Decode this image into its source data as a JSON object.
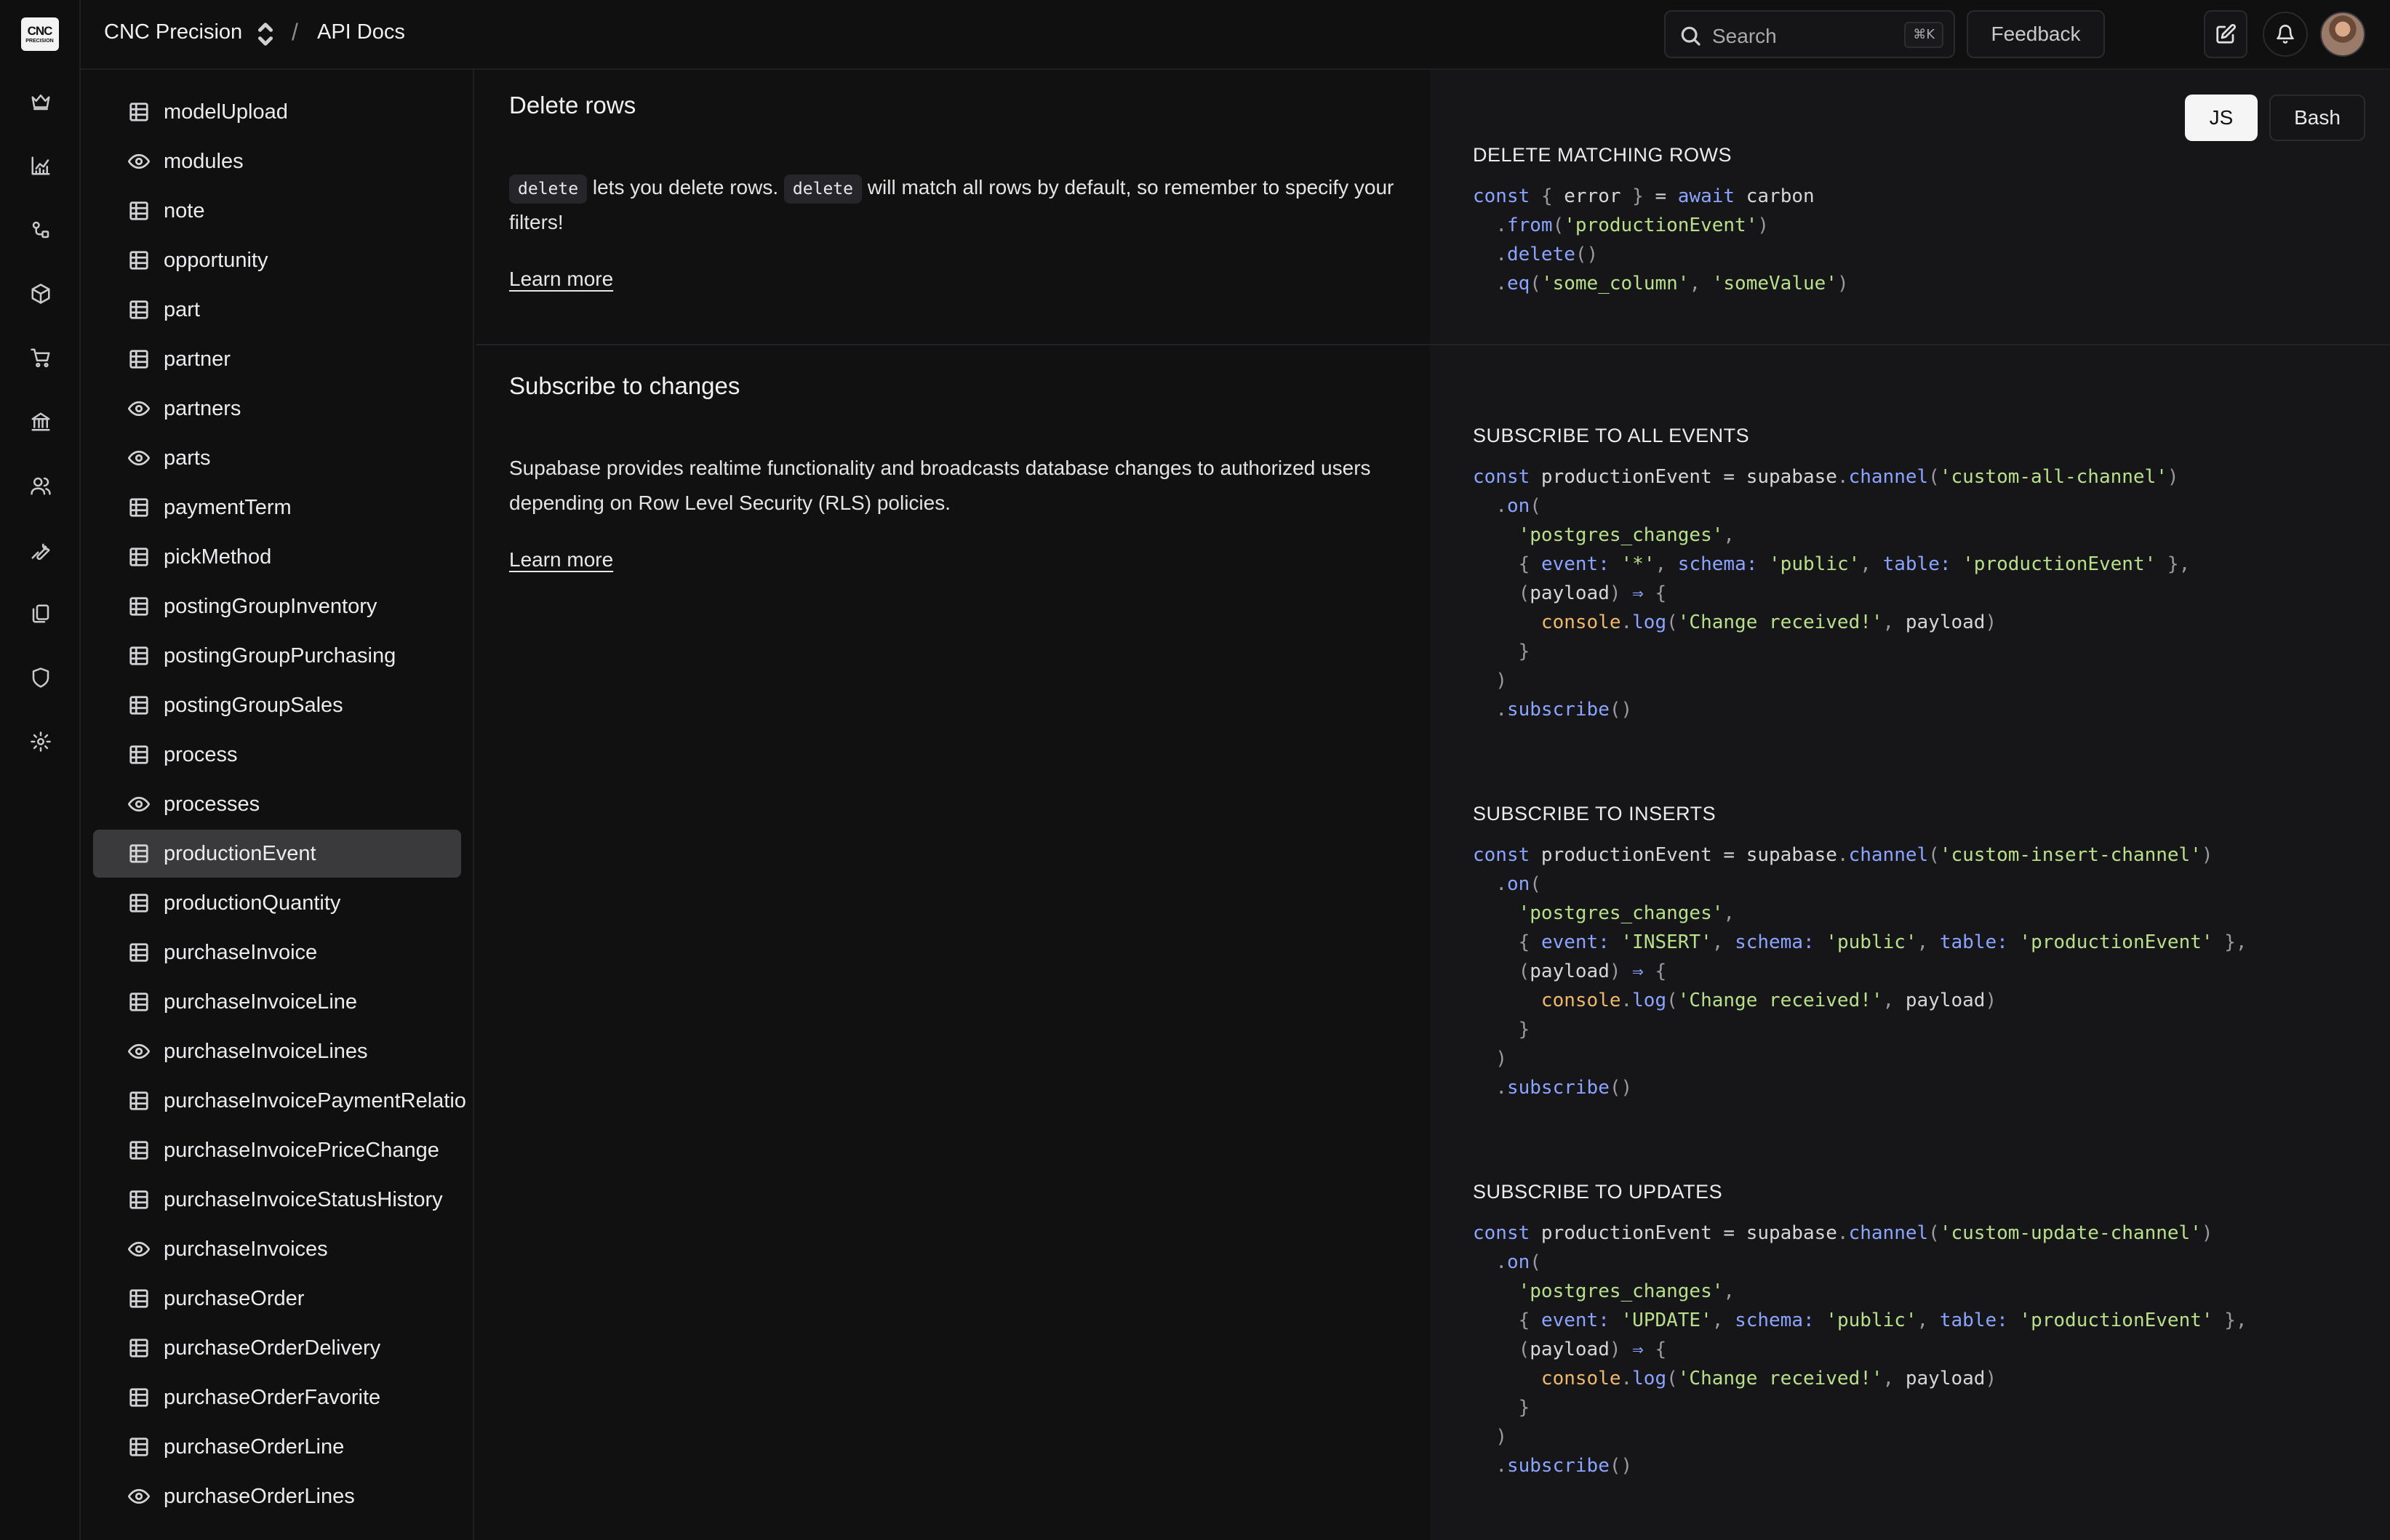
{
  "header": {
    "company": "CNC Precision",
    "separator": "/",
    "page": "API Docs",
    "search_placeholder": "Search",
    "search_shortcut": "⌘K",
    "feedback_label": "Feedback"
  },
  "rail": {
    "logo_line1": "CNC",
    "logo_line2": "PRECISION",
    "icons": [
      "crown-icon",
      "chart-icon",
      "shapes-icon",
      "box-icon",
      "cart-icon",
      "bank-icon",
      "users-icon",
      "wrench-icon",
      "files-icon",
      "shield-icon",
      "gear-icon"
    ]
  },
  "sidebar": {
    "items": [
      {
        "label": "modelUpload",
        "kind": "table"
      },
      {
        "label": "modules",
        "kind": "view"
      },
      {
        "label": "note",
        "kind": "table"
      },
      {
        "label": "opportunity",
        "kind": "table"
      },
      {
        "label": "part",
        "kind": "table"
      },
      {
        "label": "partner",
        "kind": "table"
      },
      {
        "label": "partners",
        "kind": "view"
      },
      {
        "label": "parts",
        "kind": "view"
      },
      {
        "label": "paymentTerm",
        "kind": "table"
      },
      {
        "label": "pickMethod",
        "kind": "table"
      },
      {
        "label": "postingGroupInventory",
        "kind": "table"
      },
      {
        "label": "postingGroupPurchasing",
        "kind": "table"
      },
      {
        "label": "postingGroupSales",
        "kind": "table"
      },
      {
        "label": "process",
        "kind": "table"
      },
      {
        "label": "processes",
        "kind": "view"
      },
      {
        "label": "productionEvent",
        "kind": "table",
        "active": true
      },
      {
        "label": "productionQuantity",
        "kind": "table"
      },
      {
        "label": "purchaseInvoice",
        "kind": "table"
      },
      {
        "label": "purchaseInvoiceLine",
        "kind": "table"
      },
      {
        "label": "purchaseInvoiceLines",
        "kind": "view"
      },
      {
        "label": "purchaseInvoicePaymentRelatio",
        "kind": "table"
      },
      {
        "label": "purchaseInvoicePriceChange",
        "kind": "table"
      },
      {
        "label": "purchaseInvoiceStatusHistory",
        "kind": "table"
      },
      {
        "label": "purchaseInvoices",
        "kind": "view"
      },
      {
        "label": "purchaseOrder",
        "kind": "table"
      },
      {
        "label": "purchaseOrderDelivery",
        "kind": "table"
      },
      {
        "label": "purchaseOrderFavorite",
        "kind": "table"
      },
      {
        "label": "purchaseOrderLine",
        "kind": "table"
      },
      {
        "label": "purchaseOrderLines",
        "kind": "view"
      }
    ]
  },
  "delete_section": {
    "title": "Delete rows",
    "code1": "delete",
    "text1": " lets you delete rows. ",
    "code2": "delete",
    "text2": " will match all rows by default, so remember to specify your filters!",
    "learn_more": "Learn more"
  },
  "subscribe_section": {
    "title": "Subscribe to changes",
    "body": "Supabase provides realtime functionality and broadcasts database changes to authorized users depending on Row Level Security (RLS) policies.",
    "learn_more": "Learn more"
  },
  "lang_tabs": {
    "js": "JS",
    "bash": "Bash"
  },
  "code": {
    "delete_heading": "DELETE MATCHING ROWS",
    "all_heading": "SUBSCRIBE TO ALL EVENTS",
    "inserts_heading": "SUBSCRIBE TO INSERTS",
    "updates_heading": "SUBSCRIBE TO UPDATES",
    "table": "productionEvent",
    "all_channel": "custom-all-channel",
    "insert_channel": "custom-insert-channel",
    "update_channel": "custom-update-channel",
    "event_all": "*",
    "event_insert": "INSERT",
    "event_update": "UPDATE",
    "column": "some_column",
    "value": "someValue",
    "message": "Change received!"
  }
}
